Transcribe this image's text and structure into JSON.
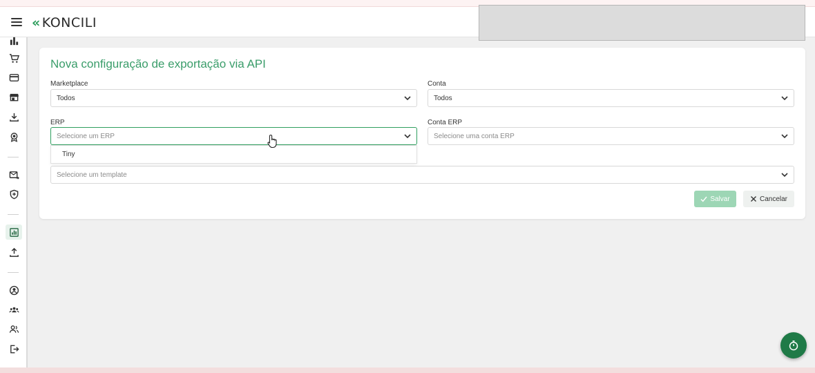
{
  "app": {
    "brand": "KONCILI",
    "brand_mark": "«"
  },
  "colors": {
    "accent": "#3a9d6a",
    "brand_green": "#2e9e5e",
    "save_button": "#9dd6b5",
    "fab": "#1f7a47"
  },
  "sidebar": {
    "items": [
      {
        "icon": "bar-chart-icon"
      },
      {
        "icon": "cart-icon"
      },
      {
        "icon": "credit-card-icon"
      },
      {
        "icon": "store-icon"
      },
      {
        "icon": "download-icon"
      },
      {
        "icon": "award-icon"
      },
      {
        "icon": "mail-forward-icon"
      },
      {
        "icon": "shield-icon"
      },
      {
        "icon": "report-icon",
        "active": true
      },
      {
        "icon": "upload-icon"
      },
      {
        "icon": "user-circle-icon"
      },
      {
        "icon": "groups-icon"
      },
      {
        "icon": "users-icon"
      },
      {
        "icon": "logout-icon"
      }
    ]
  },
  "form": {
    "title": "Nova configuração de exportação via API",
    "marketplace": {
      "label": "Marketplace",
      "value": "Todos"
    },
    "conta": {
      "label": "Conta",
      "value": "Todos"
    },
    "erp": {
      "label": "ERP",
      "placeholder": "Selecione um ERP",
      "options": [
        "Tiny"
      ]
    },
    "conta_erp": {
      "label": "Conta ERP",
      "placeholder": "Selecione uma conta ERP"
    },
    "template": {
      "placeholder": "Selecione um template"
    },
    "save_label": "Salvar",
    "cancel_label": "Cancelar"
  }
}
